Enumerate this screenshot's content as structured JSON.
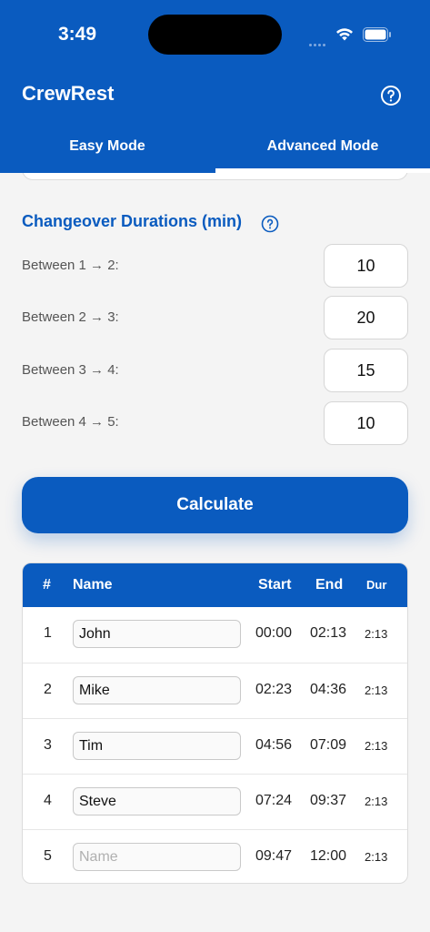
{
  "status_bar": {
    "time": "3:49"
  },
  "app": {
    "title": "CrewRest"
  },
  "tabs": [
    {
      "label": "Easy Mode",
      "selected": false
    },
    {
      "label": "Advanced Mode",
      "selected": true
    }
  ],
  "changeover": {
    "title": "Changeover Durations (min)",
    "rows": [
      {
        "label": "Between 1 → 2:",
        "value": "10"
      },
      {
        "label": "Between 2 → 3:",
        "value": "20"
      },
      {
        "label": "Between 3 → 4:",
        "value": "15"
      },
      {
        "label": "Between 4 → 5:",
        "value": "10"
      }
    ]
  },
  "calculate_label": "Calculate",
  "table": {
    "headers": {
      "num": "#",
      "name": "Name",
      "start": "Start",
      "end": "End",
      "dur": "Dur"
    },
    "rows": [
      {
        "num": "1",
        "name": "John",
        "start": "00:00",
        "end": "02:13",
        "dur": "2:13"
      },
      {
        "num": "2",
        "name": "Mike",
        "start": "02:23",
        "end": "04:36",
        "dur": "2:13"
      },
      {
        "num": "3",
        "name": "Tim",
        "start": "04:56",
        "end": "07:09",
        "dur": "2:13"
      },
      {
        "num": "4",
        "name": "Steve",
        "start": "07:24",
        "end": "09:37",
        "dur": "2:13"
      },
      {
        "num": "5",
        "name": "",
        "name_placeholder": "Name",
        "start": "09:47",
        "end": "12:00",
        "dur": "2:13"
      }
    ]
  },
  "colors": {
    "primary": "#0a5bbf",
    "background": "#f4f4f4"
  }
}
